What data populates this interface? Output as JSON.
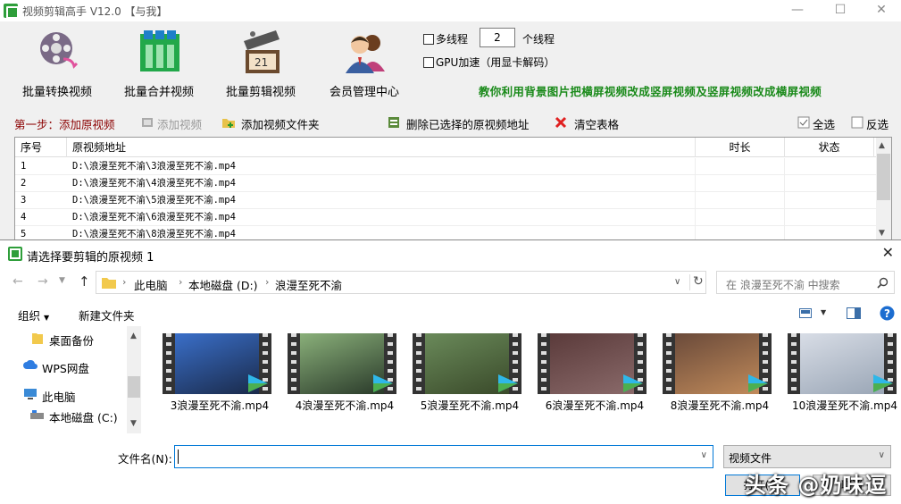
{
  "app": {
    "title": "视频剪辑高手 V12.0 【与我】",
    "tools": [
      {
        "label": "批量转换视频"
      },
      {
        "label": "批量合并视频"
      },
      {
        "label": "批量剪辑视频"
      },
      {
        "label": "会员管理中心"
      }
    ],
    "options": {
      "multithread_label": "多线程",
      "thread_count": "2",
      "thread_unit": "个线程",
      "gpu_label": "GPU加速（用显卡解码）"
    },
    "promo_text": "教你利用背景图片把横屏视频改成竖屏视频及竖屏视频改成横屏视频",
    "steps": {
      "step1": "第一步：添加原视频",
      "add_video": "添加视频",
      "add_folder": "添加视频文件夹",
      "delete_selected": "删除已选择的原视频地址",
      "clear_table": "清空表格",
      "select_all": "全选",
      "invert": "反选"
    },
    "table": {
      "headers": [
        "序号",
        "原视频地址",
        "时长",
        "状态"
      ],
      "rows": [
        {
          "index": "1",
          "path": "D:\\浪漫至死不渝\\3浪漫至死不渝.mp4"
        },
        {
          "index": "2",
          "path": "D:\\浪漫至死不渝\\4浪漫至死不渝.mp4"
        },
        {
          "index": "3",
          "path": "D:\\浪漫至死不渝\\5浪漫至死不渝.mp4"
        },
        {
          "index": "4",
          "path": "D:\\浪漫至死不渝\\6浪漫至死不渝.mp4"
        },
        {
          "index": "5",
          "path": "D:\\浪漫至死不渝\\8浪漫至死不渝.mp4"
        }
      ]
    }
  },
  "dialog": {
    "title": "请选择要剪辑的原视频 1",
    "breadcrumb": [
      "此电脑",
      "本地磁盘 (D:)",
      "浪漫至死不渝"
    ],
    "search_placeholder": "在 浪漫至死不渝 中搜索",
    "organize": "组织",
    "new_folder": "新建文件夹",
    "nav": [
      "桌面备份",
      "WPS网盘",
      "此电脑",
      "本地磁盘 (C:)"
    ],
    "files": [
      "3浪漫至死不渝.mp4",
      "4浪漫至死不渝.mp4",
      "5浪漫至死不渝.mp4",
      "6浪漫至死不渝.mp4",
      "8浪漫至死不渝.mp4",
      "10浪漫至死不渝.mp4"
    ],
    "filename_label": "文件名(N):",
    "filename_value": "",
    "filetype": "视频文件",
    "open_button": "打开(O)",
    "cancel_button": "取消"
  },
  "watermark": "头条 @奶味逗",
  "colors": {
    "promo": "#1a8a1a",
    "step_label": "#8b0000",
    "accent": "#0078d7"
  }
}
